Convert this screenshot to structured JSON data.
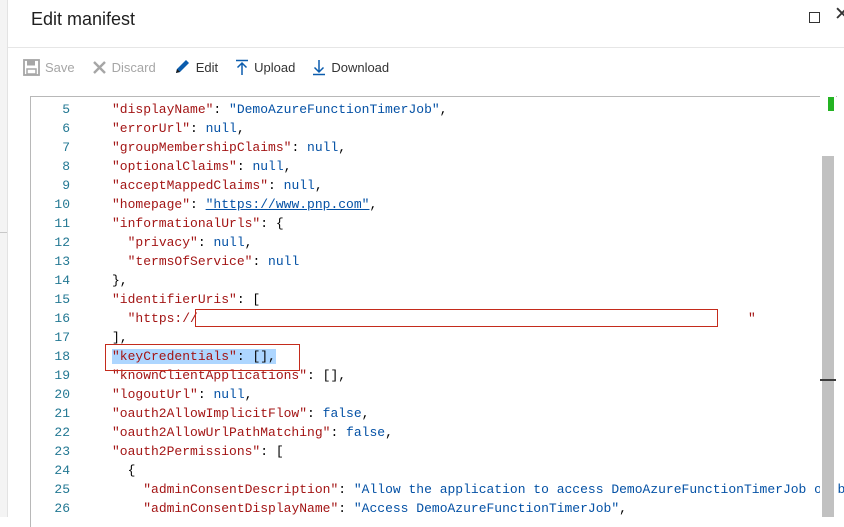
{
  "panel": {
    "title": "Edit manifest"
  },
  "toolbar": {
    "save_label": "Save",
    "discard_label": "Discard",
    "edit_label": "Edit",
    "upload_label": "Upload",
    "download_label": "Download"
  },
  "colors": {
    "key": "#a31515",
    "string_value": "#0451a5",
    "line_number": "#237893",
    "selection": "#add6ff",
    "annotation_box": "#c42b1c",
    "scrollbar_marker": "#24b323"
  },
  "editor": {
    "lines": [
      {
        "num": "5",
        "key": "\"displayName\"",
        "sep": ": ",
        "value": "\"DemoAzureFunctionTimerJob\"",
        "vtype": "s",
        "tail": ","
      },
      {
        "num": "6",
        "key": "\"errorUrl\"",
        "sep": ": ",
        "value": "null",
        "vtype": "s",
        "tail": ","
      },
      {
        "num": "7",
        "key": "\"groupMembershipClaims\"",
        "sep": ": ",
        "value": "null",
        "vtype": "s",
        "tail": ","
      },
      {
        "num": "8",
        "key": "\"optionalClaims\"",
        "sep": ": ",
        "value": "null",
        "vtype": "s",
        "tail": ","
      },
      {
        "num": "9",
        "key": "\"acceptMappedClaims\"",
        "sep": ": ",
        "value": "null",
        "vtype": "s",
        "tail": ","
      },
      {
        "num": "10",
        "key": "\"homepage\"",
        "sep": ": ",
        "value": "\"https://www.pnp.com\"",
        "vtype": "s",
        "underline": true,
        "tail": ","
      },
      {
        "num": "11",
        "key": "\"informationalUrls\"",
        "sep": ": {",
        "value": "",
        "vtype": "s",
        "tail": ""
      },
      {
        "num": "12",
        "indent": "  ",
        "key": "\"privacy\"",
        "sep": ": ",
        "value": "null",
        "vtype": "s",
        "tail": ","
      },
      {
        "num": "13",
        "indent": "  ",
        "key": "\"termsOfService\"",
        "sep": ": ",
        "value": "null",
        "vtype": "s",
        "tail": ""
      },
      {
        "num": "14",
        "punct": "},"
      },
      {
        "num": "15",
        "key": "\"identifierUris\"",
        "sep": ": [",
        "value": "",
        "vtype": "s",
        "tail": ""
      },
      {
        "num": "16",
        "indent": "  ",
        "key": "",
        "sep": "",
        "value": "\"https://",
        "vtype": "k",
        "tail": "",
        "after_gap": "\""
      },
      {
        "num": "17",
        "punct": "],"
      },
      {
        "num": "18",
        "key": "\"keyCredentials\"",
        "sep": ": ",
        "value": "[]",
        "vtype": "p",
        "tail": ",",
        "selected": true
      },
      {
        "num": "19",
        "key": "\"knownClientApplications\"",
        "sep": ": ",
        "value": "[]",
        "vtype": "p",
        "tail": ","
      },
      {
        "num": "20",
        "key": "\"logoutUrl\"",
        "sep": ": ",
        "value": "null",
        "vtype": "s",
        "tail": ","
      },
      {
        "num": "21",
        "key": "\"oauth2AllowImplicitFlow\"",
        "sep": ": ",
        "value": "false",
        "vtype": "s",
        "tail": ","
      },
      {
        "num": "22",
        "key": "\"oauth2AllowUrlPathMatching\"",
        "sep": ": ",
        "value": "false",
        "vtype": "s",
        "tail": ","
      },
      {
        "num": "23",
        "key": "\"oauth2Permissions\"",
        "sep": ": [",
        "value": "",
        "vtype": "s",
        "tail": ""
      },
      {
        "num": "24",
        "indent": "  ",
        "punct": "{"
      },
      {
        "num": "25",
        "indent": "    ",
        "key": "\"adminConsentDescription\"",
        "sep": ": ",
        "value": "\"Allow the application to access DemoAzureFunctionTimerJob on b",
        "vtype": "s",
        "tail": ""
      },
      {
        "num": "26",
        "indent": "    ",
        "key": "\"adminConsentDisplayName\"",
        "sep": ": ",
        "value": "\"Access DemoAzureFunctionTimerJob\"",
        "vtype": "s",
        "tail": ","
      }
    ]
  }
}
